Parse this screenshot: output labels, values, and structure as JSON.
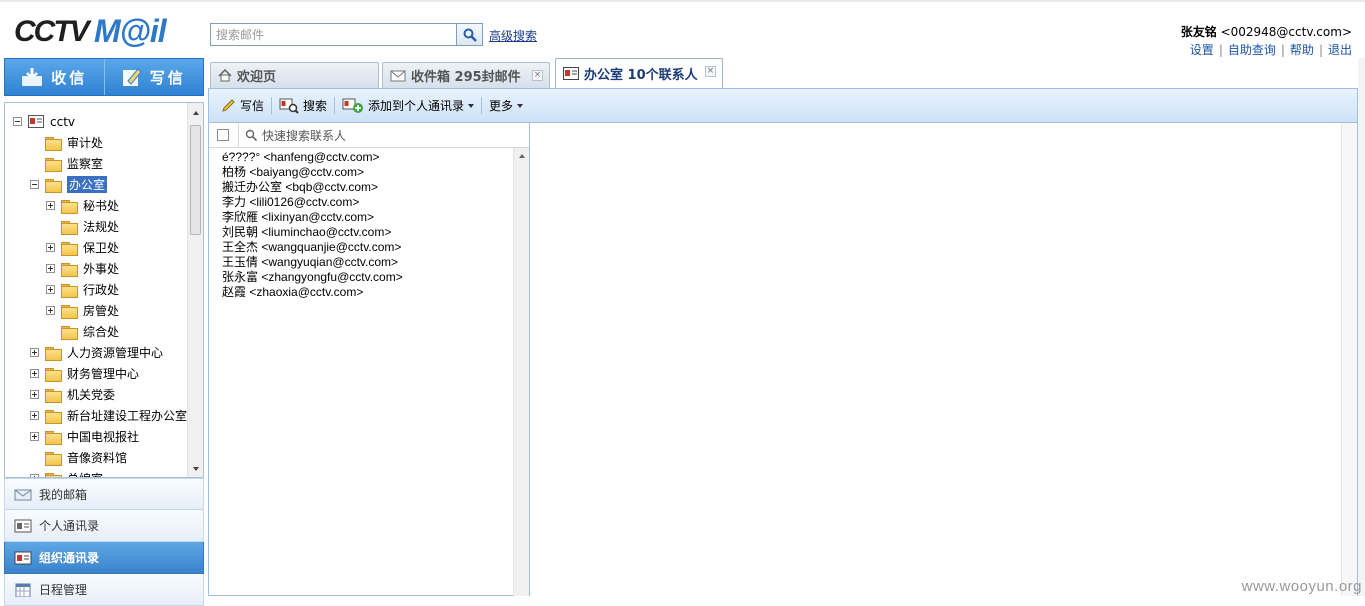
{
  "header": {
    "logo_text": "CCTVM@il",
    "search_placeholder": "搜索邮件",
    "advanced_search": "高级搜索",
    "user_name": "张友铭",
    "user_email": "<002948@cctv.com>",
    "links": [
      "设置",
      "自助查询",
      "帮助",
      "退出"
    ]
  },
  "compose": {
    "receive": "收信",
    "write": "写信"
  },
  "tree": {
    "root": "cctv",
    "items": [
      "审计处",
      "监察室",
      "办公室",
      "秘书处",
      "法规处",
      "保卫处",
      "外事处",
      "行政处",
      "房管处",
      "综合处",
      "人力资源管理中心",
      "财务管理中心",
      "机关党委",
      "新台址建设工程办公室",
      "中国电视报社",
      "音像资料馆",
      "总编室"
    ]
  },
  "nav": [
    "我的邮箱",
    "个人通讯录",
    "组织通讯录",
    "日程管理"
  ],
  "tabs": {
    "welcome": "欢迎页",
    "inbox": "收件箱 295封邮件",
    "office": "办公室 10个联系人"
  },
  "toolbar": {
    "write": "写信",
    "search": "搜索",
    "add_personal": "添加到个人通讯录",
    "more": "更多"
  },
  "quick_search_placeholder": "快速搜索联系人",
  "contacts": [
    "é????° <hanfeng@cctv.com>",
    "柏杨 <baiyang@cctv.com>",
    "搬迁办公室 <bqb@cctv.com>",
    "李力 <lili0126@cctv.com>",
    "李欣雁 <lixinyan@cctv.com>",
    "刘民朝 <liuminchao@cctv.com>",
    "王全杰 <wangquanjie@cctv.com>",
    "王玉倩 <wangyuqian@cctv.com>",
    "张永富 <zhangyongfu@cctv.com>",
    "赵霞 <zhaoxia@cctv.com>"
  ],
  "watermark": "www.wooyun.org",
  "colors": {
    "accent": "#3a83cc",
    "link": "#1a55a5",
    "folder": "#f2c54f"
  }
}
